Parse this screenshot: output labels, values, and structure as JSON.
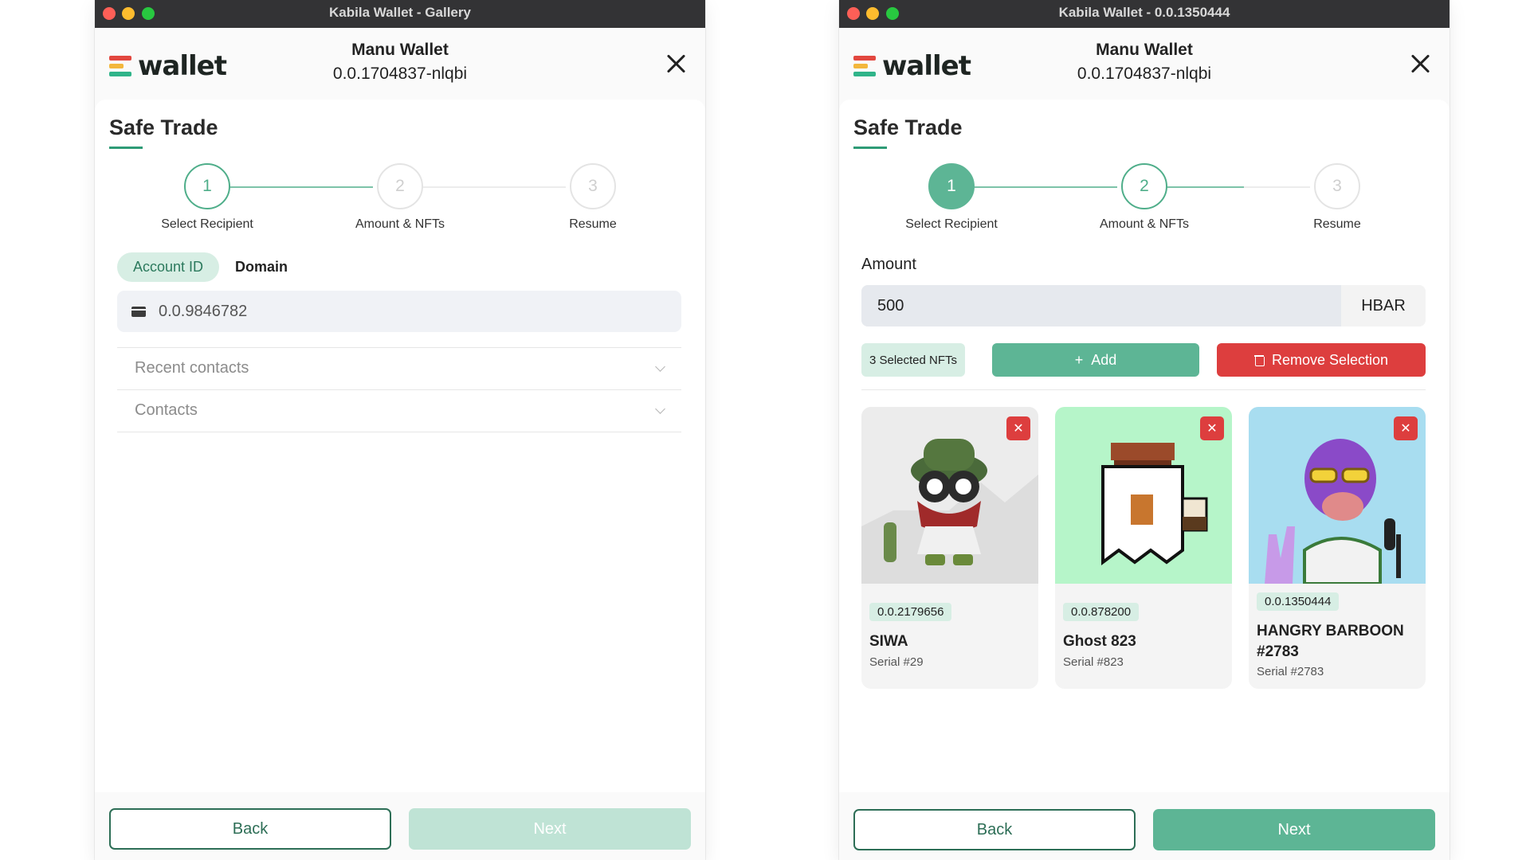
{
  "windows": [
    {
      "title": "Kabila Wallet - Gallery",
      "header": {
        "logo_text": "wallet",
        "account_name": "Manu Wallet",
        "account_id": "0.0.1704837-nlqbi"
      },
      "page_title": "Safe Trade",
      "steps": [
        {
          "number": "1",
          "label": "Select Recipient",
          "state": "active"
        },
        {
          "number": "2",
          "label": "Amount & NFTs",
          "state": "inactive"
        },
        {
          "number": "3",
          "label": "Resume",
          "state": "inactive"
        }
      ],
      "tabs": {
        "account_id": "Account ID",
        "domain": "Domain"
      },
      "recipient_field_value": "0.0.9846782",
      "accordions": [
        "Recent contacts",
        "Contacts"
      ],
      "footer": {
        "back": "Back",
        "next": "Next",
        "next_enabled": false
      }
    },
    {
      "title": "Kabila Wallet - 0.0.1350444",
      "header": {
        "logo_text": "wallet",
        "account_name": "Manu Wallet",
        "account_id": "0.0.1704837-nlqbi"
      },
      "page_title": "Safe Trade",
      "steps": [
        {
          "number": "1",
          "label": "Select Recipient",
          "state": "done"
        },
        {
          "number": "2",
          "label": "Amount & NFTs",
          "state": "active"
        },
        {
          "number": "3",
          "label": "Resume",
          "state": "inactive"
        }
      ],
      "amount_label": "Amount",
      "amount_value": "500",
      "amount_unit": "HBAR",
      "selected_count_label": "3 Selected NFTs",
      "add_label": "Add",
      "remove_label": "Remove Selection",
      "nfts": [
        {
          "token_id": "0.0.2179656",
          "name": "SIWA",
          "serial": "Serial #29",
          "bg": "#ececec"
        },
        {
          "token_id": "0.0.878200",
          "name": "Ghost 823",
          "serial": "Serial #823",
          "bg": "#b6f5c9"
        },
        {
          "token_id": "0.0.1350444",
          "name": "HANGRY BARBOON #2783",
          "serial": "Serial #2783",
          "bg": "#a8ddf0"
        }
      ],
      "footer": {
        "back": "Back",
        "next": "Next",
        "next_enabled": true
      }
    }
  ],
  "colors": {
    "accent": "#5db595",
    "accent_light": "#d7eee4",
    "danger": "#dd3e3e",
    "titlebar": "#333335"
  }
}
